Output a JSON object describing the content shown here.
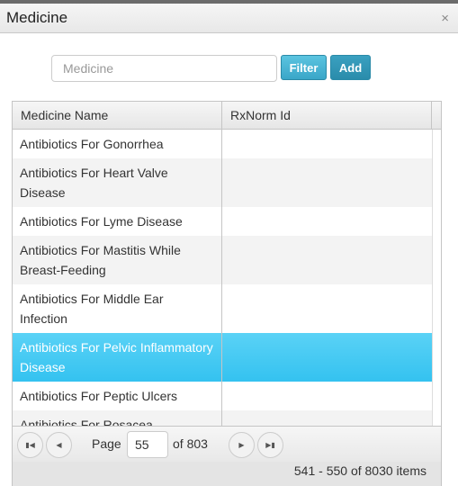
{
  "dialog": {
    "title": "Medicine",
    "close_icon": "×"
  },
  "search": {
    "placeholder": "Medicine",
    "value": ""
  },
  "buttons": {
    "filter": "Filter",
    "add": "Add"
  },
  "grid": {
    "columns": [
      "Medicine Name",
      "RxNorm Id"
    ],
    "rows": [
      {
        "name": "Antibiotics For Gonorrhea",
        "rxnorm": ""
      },
      {
        "name": "Antibiotics For Heart Valve Disease",
        "rxnorm": ""
      },
      {
        "name": "Antibiotics For Lyme Disease",
        "rxnorm": ""
      },
      {
        "name": "Antibiotics For Mastitis While Breast-Feeding",
        "rxnorm": ""
      },
      {
        "name": "Antibiotics For Middle Ear Infection",
        "rxnorm": ""
      },
      {
        "name": "Antibiotics For Pelvic Inflammatory Disease",
        "rxnorm": "",
        "selected": true
      },
      {
        "name": "Antibiotics For Peptic Ulcers",
        "rxnorm": ""
      },
      {
        "name": "Antibiotics For Rosacea",
        "rxnorm": ""
      }
    ],
    "selection_color": "#34c2f0"
  },
  "pager": {
    "page_label": "Page",
    "page": "55",
    "of_label": "of 803",
    "info": "541 - 550 of 8030 items"
  }
}
